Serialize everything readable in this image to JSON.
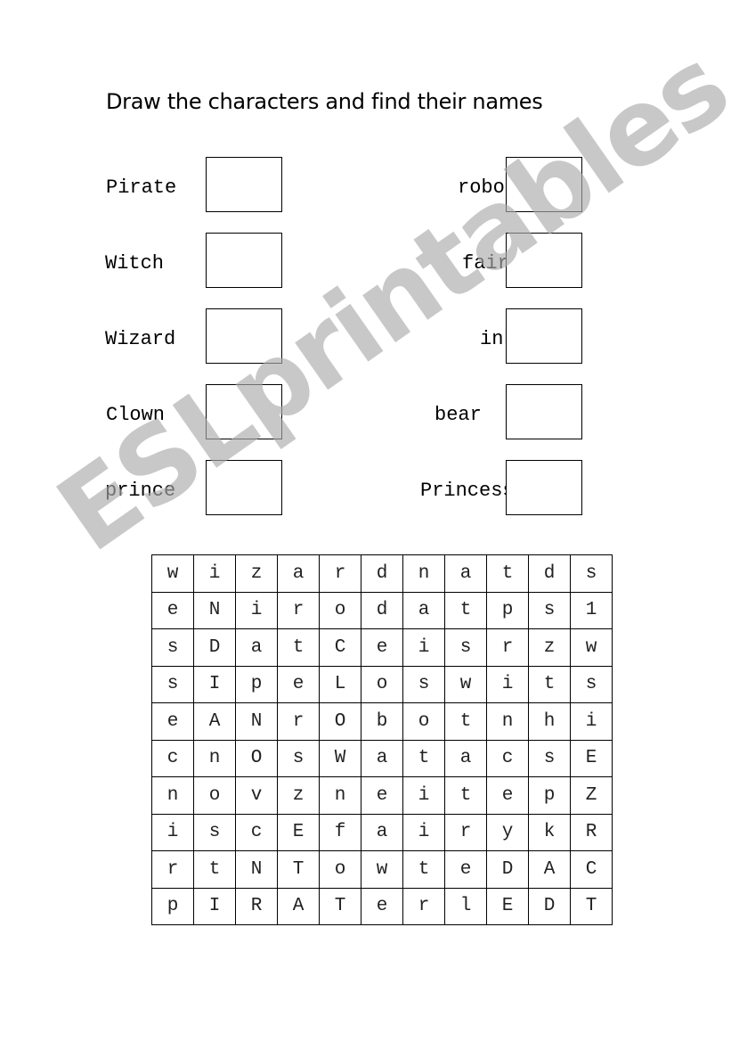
{
  "title": "Draw the characters and find their  names",
  "left_labels": [
    "Pirate",
    "Witch",
    "Wizard",
    "Clown",
    "prince"
  ],
  "right_labels": [
    "robot",
    "fairy",
    "ink",
    "bear",
    "Princess"
  ],
  "grid": [
    [
      "w",
      "i",
      "z",
      "a",
      "r",
      "d",
      "n",
      "a",
      "t",
      "d",
      "s"
    ],
    [
      "e",
      "N",
      "i",
      "r",
      "o",
      "d",
      "a",
      "t",
      "p",
      "s",
      "1"
    ],
    [
      "s",
      "D",
      "a",
      "t",
      "C",
      "e",
      "i",
      "s",
      "r",
      "z",
      "w"
    ],
    [
      "s",
      "I",
      "p",
      "e",
      "L",
      "o",
      "s",
      "w",
      "i",
      "t",
      "s"
    ],
    [
      "e",
      "A",
      "N",
      "r",
      "O",
      "b",
      "o",
      "t",
      "n",
      "h",
      "i"
    ],
    [
      "c",
      "n",
      "O",
      "s",
      "W",
      "a",
      "t",
      "a",
      "c",
      "s",
      "E"
    ],
    [
      "n",
      "o",
      "v",
      "z",
      "n",
      "e",
      "i",
      "t",
      "e",
      "p",
      "Z"
    ],
    [
      "i",
      "s",
      "c",
      "E",
      "f",
      "a",
      "i",
      "r",
      "y",
      "k",
      "R"
    ],
    [
      "r",
      "t",
      "N",
      "T",
      "o",
      "w",
      "t",
      "e",
      "D",
      "A",
      "C"
    ],
    [
      "p",
      "I",
      "R",
      "A",
      "T",
      "e",
      "r",
      "l",
      "E",
      "D",
      "T"
    ]
  ],
  "watermark": "ESLprintables.com"
}
